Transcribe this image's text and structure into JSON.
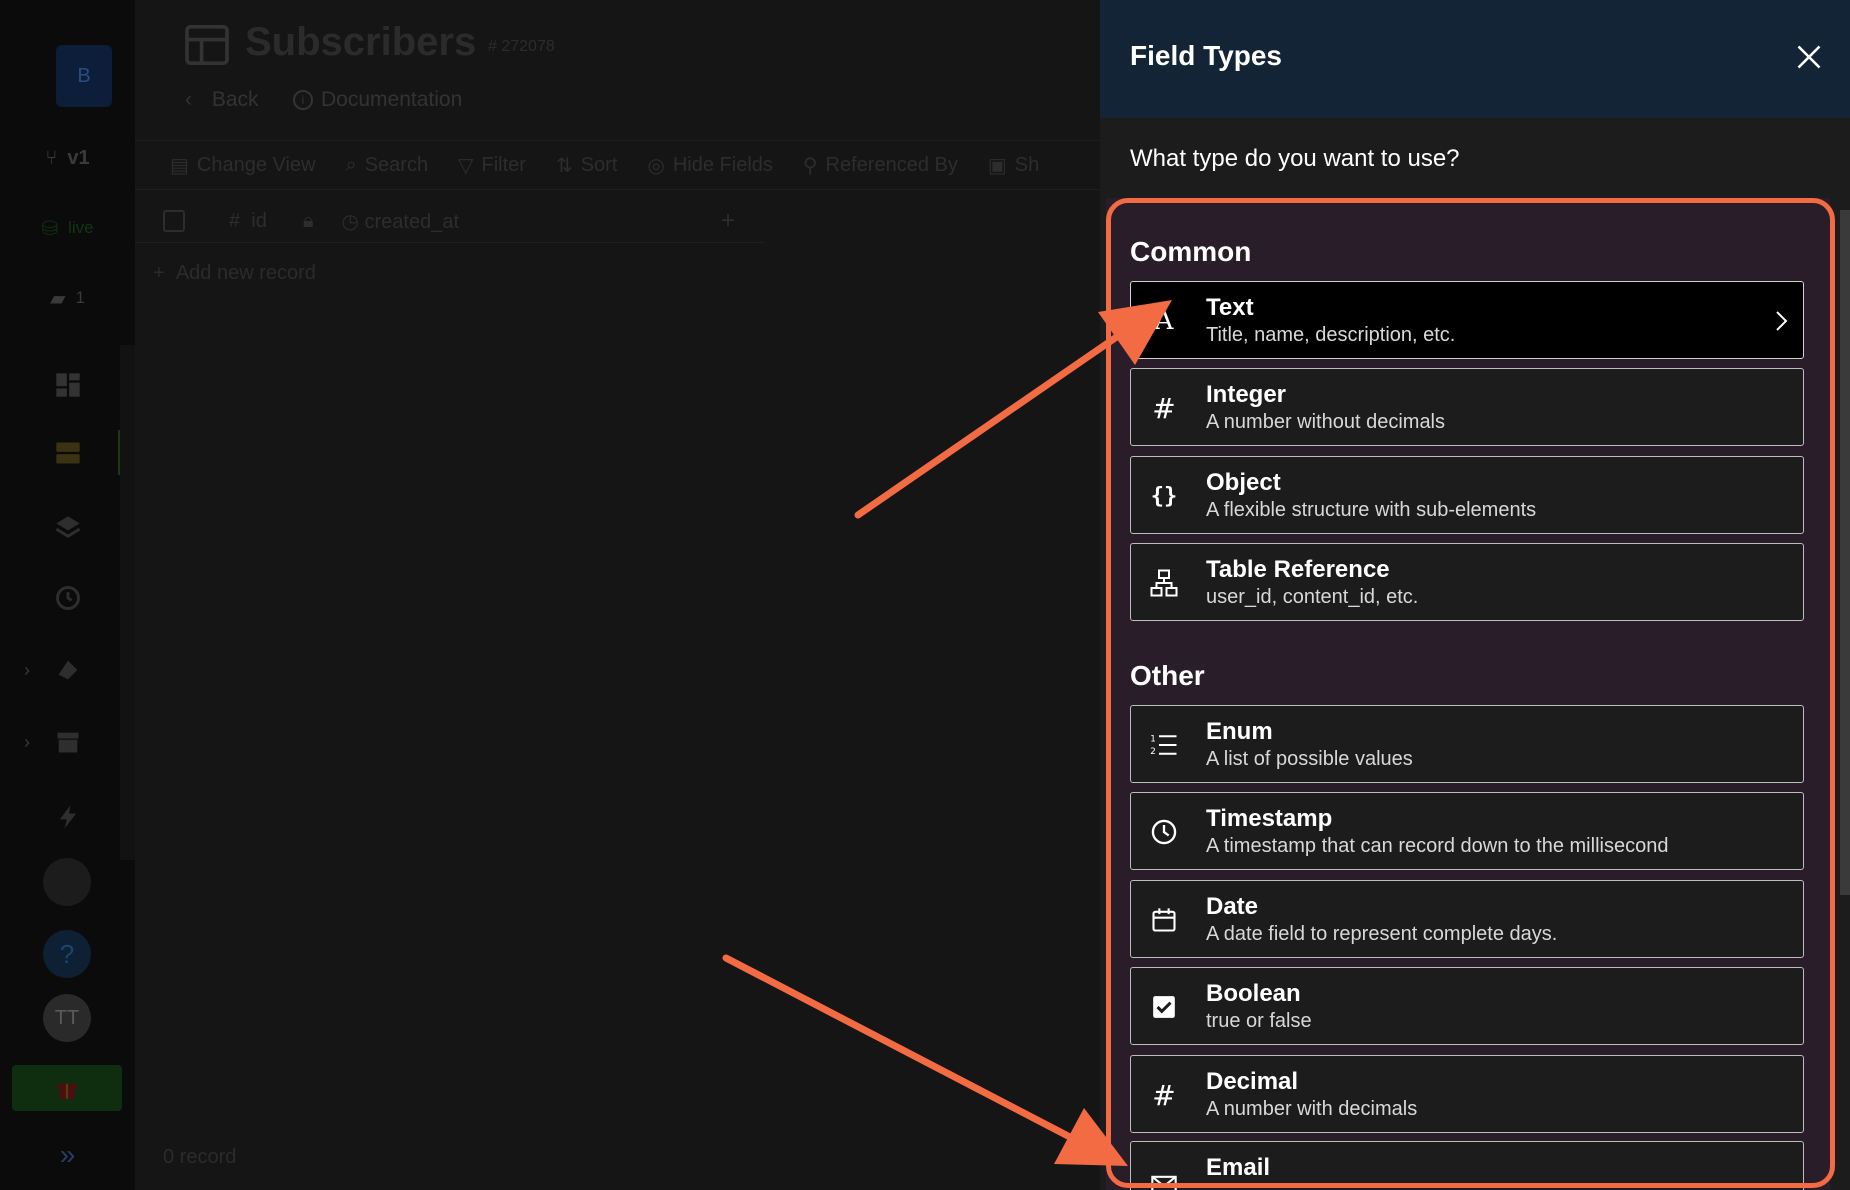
{
  "sidebar": {
    "workspace_initial": "B",
    "branch_label": "v1",
    "db_label": "live",
    "comments_count": "1",
    "user_initials": "TT",
    "active_accent": "#233512"
  },
  "main": {
    "title": "Subscribers",
    "id_label": "# 272078",
    "back_label": "Back",
    "documentation_label": "Documentation",
    "toolbar": {
      "change_view": "Change View",
      "search": "Search",
      "filter": "Filter",
      "sort": "Sort",
      "hide_fields": "Hide Fields",
      "referenced_by": "Referenced By",
      "sh": "Sh"
    },
    "columns": [
      "id",
      "created_at"
    ],
    "add_record_label": "Add new record",
    "record_count": "0 record"
  },
  "drawer": {
    "title": "Field Types",
    "question": "What type do you want to use?",
    "header_color": "#142437",
    "common_title": "Common",
    "other_title": "Other",
    "common_types": [
      {
        "icon": "text-icon",
        "label": "Text",
        "desc": "Title, name, description, etc."
      },
      {
        "icon": "hash-icon",
        "label": "Integer",
        "desc": "A number without decimals"
      },
      {
        "icon": "braces-icon",
        "label": "Object",
        "desc": "A flexible structure with sub-elements"
      },
      {
        "icon": "table-reference-icon",
        "label": "Table Reference",
        "desc": "user_id, content_id, etc."
      }
    ],
    "other_types": [
      {
        "icon": "ordered-list-icon",
        "label": "Enum",
        "desc": "A list of possible values"
      },
      {
        "icon": "clock-icon",
        "label": "Timestamp",
        "desc": "A timestamp that can record down to the millisecond"
      },
      {
        "icon": "calendar-icon",
        "label": "Date",
        "desc": "A date field to represent complete days."
      },
      {
        "icon": "checkbox-icon",
        "label": "Boolean",
        "desc": "true or false"
      },
      {
        "icon": "hash-icon",
        "label": "Decimal",
        "desc": "A number with decimals"
      },
      {
        "icon": "envelope-icon",
        "label": "Email",
        "desc": ""
      }
    ]
  },
  "annotation_color": "#f26b43"
}
